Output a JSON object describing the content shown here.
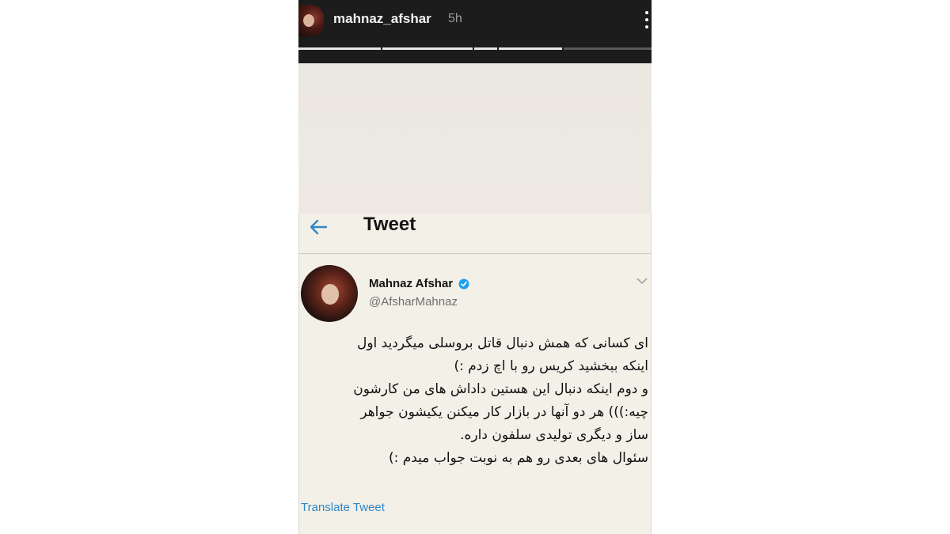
{
  "story": {
    "username": "mahnaz_afshar",
    "time": "5h",
    "progress": [
      1,
      1,
      1,
      1,
      0,
      0,
      0
    ]
  },
  "tweet": {
    "heading": "Tweet",
    "author_name": "Mahnaz Afshar",
    "author_handle": "@AfsharMahnaz",
    "body_lines": [
      "ای کسانی که همش دنبال قاتل بروسلی میگردید  اول",
      "اینکه ببخشید کریس رو با اچ زدم :)",
      "و دوم اینکه دنبال این هستین داداش های من کارشون",
      "چیه:))) هر دو آنها در بازار کار میکنن یکیشون جواهر",
      "ساز و دیگری تولیدی سلفون داره.",
      "سئوال های بعدی رو هم به نوبت جواب میدم :)"
    ],
    "translate_label": "Translate Tweet"
  },
  "icons": {
    "back": "back-arrow-icon",
    "verified": "verified-badge-icon",
    "more": "more-vertical-icon",
    "chevron": "chevron-down-icon"
  },
  "colors": {
    "accent": "#2f86c6",
    "verified": "#1da1f2",
    "story_bar": "#1c1c1c"
  }
}
